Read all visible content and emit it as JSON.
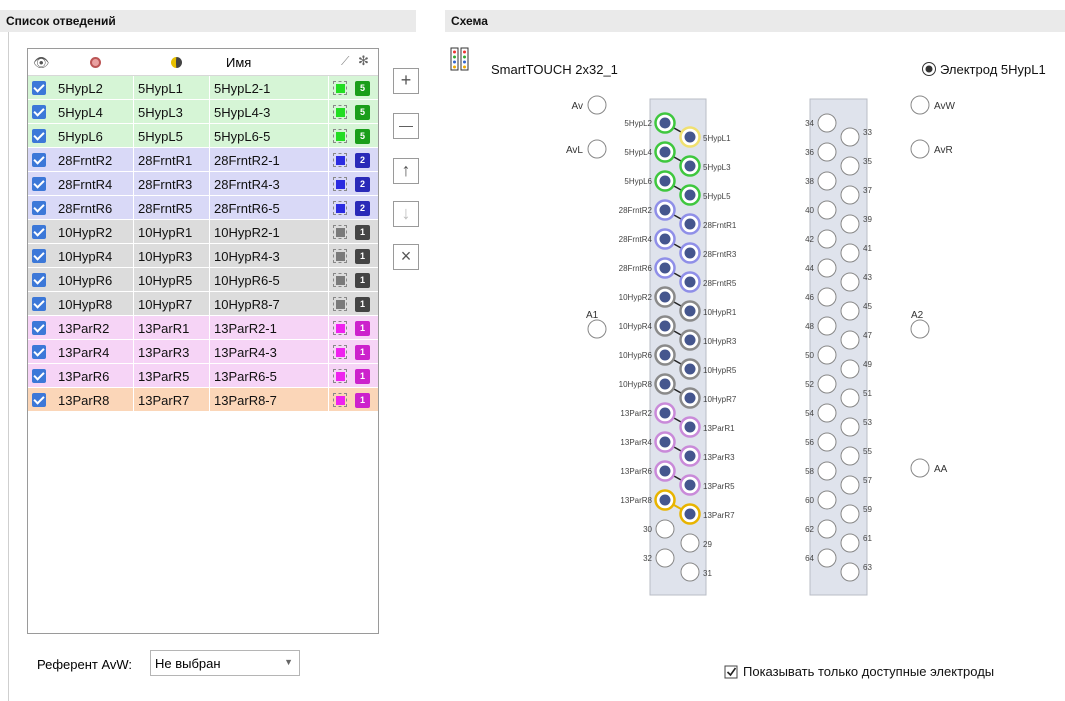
{
  "left_panel": {
    "title": "Список отведений"
  },
  "right_panel": {
    "title": "Схема"
  },
  "table": {
    "header": {
      "name_col": "Имя"
    },
    "rows": [
      {
        "c1": "5HypL2",
        "c2": "5HypL1",
        "c3": "5HypL2-1",
        "bg": "#d6f5d6",
        "color": "#22dd22",
        "badge": "5",
        "badge_color": "#1a9e1a"
      },
      {
        "c1": "5HypL4",
        "c2": "5HypL3",
        "c3": "5HypL4-3",
        "bg": "#d6f5d6",
        "color": "#22dd22",
        "badge": "5",
        "badge_color": "#1a9e1a"
      },
      {
        "c1": "5HypL6",
        "c2": "5HypL5",
        "c3": "5HypL6-5",
        "bg": "#d6f5d6",
        "color": "#22dd22",
        "badge": "5",
        "badge_color": "#1a9e1a"
      },
      {
        "c1": "28FrntR2",
        "c2": "28FrntR1",
        "c3": "28FrntR2-1",
        "bg": "#d9d9f7",
        "color": "#2b2be0",
        "badge": "2",
        "badge_color": "#2a2ab8"
      },
      {
        "c1": "28FrntR4",
        "c2": "28FrntR3",
        "c3": "28FrntR4-3",
        "bg": "#d9d9f7",
        "color": "#2b2be0",
        "badge": "2",
        "badge_color": "#2a2ab8"
      },
      {
        "c1": "28FrntR6",
        "c2": "28FrntR5",
        "c3": "28FrntR6-5",
        "bg": "#d9d9f7",
        "color": "#2b2be0",
        "badge": "2",
        "badge_color": "#2a2ab8"
      },
      {
        "c1": "10HypR2",
        "c2": "10HypR1",
        "c3": "10HypR2-1",
        "bg": "#dcdcdc",
        "color": "#7a7a7a",
        "badge": "1",
        "badge_color": "#444444"
      },
      {
        "c1": "10HypR4",
        "c2": "10HypR3",
        "c3": "10HypR4-3",
        "bg": "#dcdcdc",
        "color": "#7a7a7a",
        "badge": "1",
        "badge_color": "#444444"
      },
      {
        "c1": "10HypR6",
        "c2": "10HypR5",
        "c3": "10HypR6-5",
        "bg": "#dcdcdc",
        "color": "#7a7a7a",
        "badge": "1",
        "badge_color": "#444444"
      },
      {
        "c1": "10HypR8",
        "c2": "10HypR7",
        "c3": "10HypR8-7",
        "bg": "#dcdcdc",
        "color": "#7a7a7a",
        "badge": "1",
        "badge_color": "#444444"
      },
      {
        "c1": "13ParR2",
        "c2": "13ParR1",
        "c3": "13ParR2-1",
        "bg": "#f6d4f6",
        "color": "#ee22ee",
        "badge": "1",
        "badge_color": "#cc22cc"
      },
      {
        "c1": "13ParR4",
        "c2": "13ParR3",
        "c3": "13ParR4-3",
        "bg": "#f6d4f6",
        "color": "#ee22ee",
        "badge": "1",
        "badge_color": "#cc22cc"
      },
      {
        "c1": "13ParR6",
        "c2": "13ParR5",
        "c3": "13ParR6-5",
        "bg": "#f6d4f6",
        "color": "#ee22ee",
        "badge": "1",
        "badge_color": "#cc22cc"
      },
      {
        "c1": "13ParR8",
        "c2": "13ParR7",
        "c3": "13ParR8-7",
        "bg": "#fbd6b8",
        "color": "#ee22ee",
        "badge": "1",
        "badge_color": "#cc22cc"
      }
    ]
  },
  "toolbar": {
    "add": "+",
    "insert": "—",
    "up": "↑",
    "down": "↓",
    "remove": "×"
  },
  "referent": {
    "label": "Референт AvW:",
    "value": "Не выбран"
  },
  "scheme": {
    "device": "SmartTOUCH 2x32_1",
    "electrode_radio": "Электрод 5HypL1",
    "show_only_available": "Показывать только доступные электроды",
    "aux_left": [
      "Av",
      "AvL",
      "A1"
    ],
    "aux_right": [
      "AvW",
      "AvR",
      "A2",
      "AA"
    ],
    "chip1_left": [
      "5HypL2",
      "5HypL4",
      "5HypL6",
      "28FrntR2",
      "28FrntR4",
      "28FrntR6",
      "10HypR2",
      "10HypR4",
      "10HypR6",
      "10HypR8",
      "13ParR2",
      "13ParR4",
      "13ParR6",
      "13ParR8",
      "30",
      "32"
    ],
    "chip1_right": [
      "5HypL1",
      "5HypL3",
      "5HypL5",
      "28FrntR1",
      "28FrntR3",
      "28FrntR5",
      "10HypR1",
      "10HypR3",
      "10HypR5",
      "10HypR7",
      "13ParR1",
      "13ParR3",
      "13ParR5",
      "13ParR7",
      "29",
      "31"
    ],
    "chip2_left": [
      "34",
      "36",
      "38",
      "40",
      "42",
      "44",
      "46",
      "48",
      "50",
      "52",
      "54",
      "56",
      "58",
      "60",
      "62",
      "64"
    ],
    "chip2_right": [
      "33",
      "35",
      "37",
      "39",
      "41",
      "43",
      "45",
      "47",
      "49",
      "51",
      "53",
      "55",
      "57",
      "59",
      "61",
      "63"
    ],
    "pair_colors": [
      "#3fc73f",
      "#3fc73f",
      "#3fc73f",
      "#8f8fe8",
      "#8f8fe8",
      "#8f8fe8",
      "#8a8a8a",
      "#8a8a8a",
      "#8a8a8a",
      "#8a8a8a",
      "#c98ad9",
      "#c98ad9",
      "#c98ad9",
      "#e8b400"
    ],
    "selected_ring": "#f0e070"
  }
}
